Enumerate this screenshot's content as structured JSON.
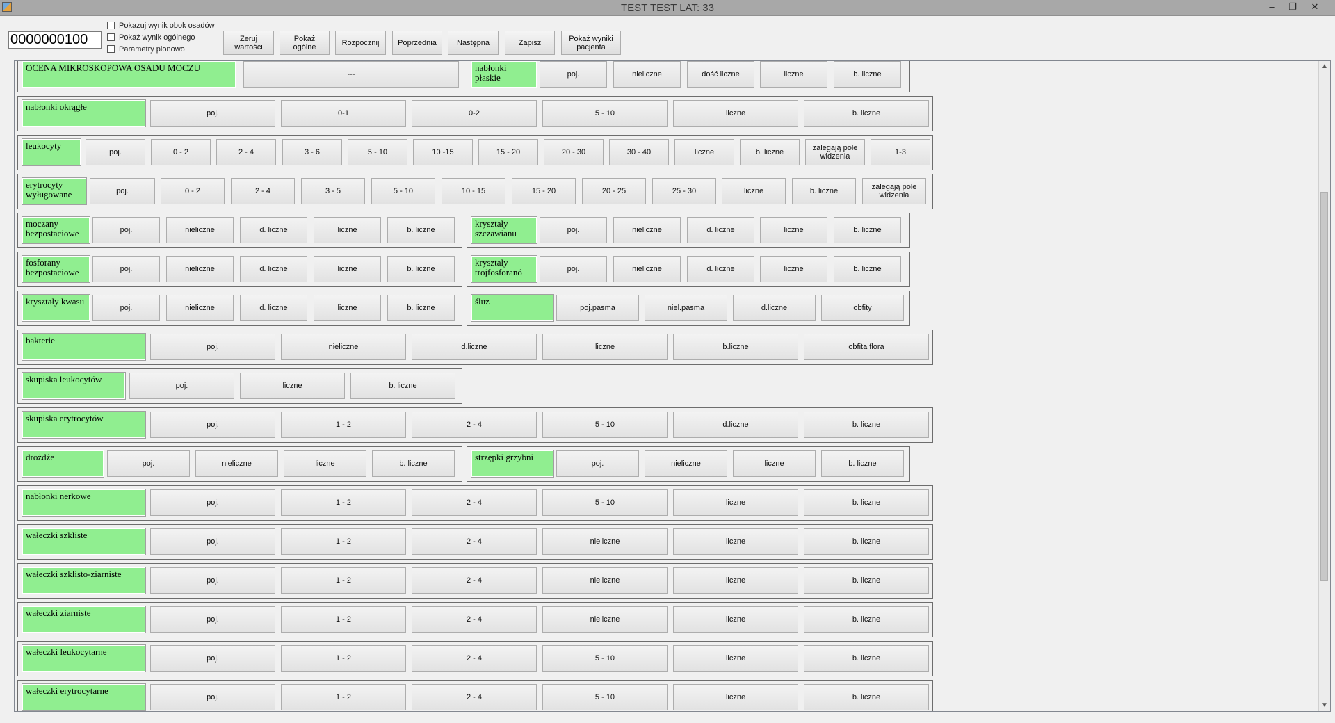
{
  "window": {
    "title": "TEST TEST  LAT: 33",
    "minimize": "–",
    "restore": "❐",
    "close": "✕"
  },
  "toolbar": {
    "id_value": "0000000100",
    "checkboxes": [
      {
        "label": "Pokazuj wynik obok osadów",
        "checked": false
      },
      {
        "label": "Pokaż wynik ogólnego",
        "checked": false
      },
      {
        "label": "Parametry pionowo",
        "checked": false
      }
    ],
    "buttons": [
      "Zeruj\nwartości",
      "Pokaż\nogólne",
      "Rozpocznij",
      "Poprzednia",
      "Następna",
      "Zapisz",
      "Pokaż wyniki\npacjenta"
    ]
  },
  "rows": [
    {
      "groups": [
        {
          "label": "OCENA MIKROSKOPOWA OSADU MOCZU",
          "options": [
            "---"
          ]
        },
        {
          "label": "nabłonki płaskie",
          "options": [
            "poj.",
            "nieliczne",
            "dość liczne",
            "liczne",
            "b. liczne"
          ]
        }
      ]
    },
    {
      "groups": [
        {
          "label": "nabłonki okrągłe",
          "options": [
            "poj.",
            "0-1",
            "0-2",
            "5 - 10",
            "liczne",
            "b. liczne"
          ]
        }
      ]
    },
    {
      "groups": [
        {
          "label": "leukocyty",
          "options": [
            "poj.",
            "0 - 2",
            "2 - 4",
            "3 - 6",
            "5 - 10",
            "10 -15",
            "15 - 20",
            "20 - 30",
            "30 - 40",
            "liczne",
            "b. liczne",
            "zalegają pole widzenia",
            "1-3"
          ]
        }
      ]
    },
    {
      "groups": [
        {
          "label": "erytrocyty wyługowane",
          "options": [
            "poj.",
            "0 - 2",
            "2 - 4",
            "3 - 5",
            "5 - 10",
            "10 - 15",
            "15 - 20",
            "20 - 25",
            "25 - 30",
            "liczne",
            "b. liczne",
            "zalegają pole widzenia"
          ]
        }
      ]
    },
    {
      "groups": [
        {
          "label": "moczany bezpostaciowe",
          "options": [
            "poj.",
            "nieliczne",
            "d. liczne",
            "liczne",
            "b. liczne"
          ]
        },
        {
          "label": "kryształy szczawianu",
          "options": [
            "poj.",
            "nieliczne",
            "d. liczne",
            "liczne",
            "b. liczne"
          ]
        }
      ]
    },
    {
      "groups": [
        {
          "label": "fosforany bezpostaciowe",
          "options": [
            "poj.",
            "nieliczne",
            "d. liczne",
            "liczne",
            "b. liczne"
          ]
        },
        {
          "label": "kryształy trojfosforanó",
          "options": [
            "poj.",
            "nieliczne",
            "d. liczne",
            "liczne",
            "b. liczne"
          ]
        }
      ]
    },
    {
      "groups": [
        {
          "label": "kryształy kwasu",
          "options": [
            "poj.",
            "nieliczne",
            "d. liczne",
            "liczne",
            "b. liczne"
          ]
        },
        {
          "label": "śluz",
          "options": [
            "poj.pasma",
            "niel.pasma",
            "d.liczne",
            "obfity"
          ]
        }
      ]
    },
    {
      "groups": [
        {
          "label": "bakterie",
          "options": [
            "poj.",
            "nieliczne",
            "d.liczne",
            "liczne",
            "b.liczne",
            "obfita flora"
          ]
        }
      ]
    },
    {
      "groups": [
        {
          "label": "skupiska leukocytów",
          "options": [
            "poj.",
            "liczne",
            "b. liczne"
          ]
        }
      ]
    },
    {
      "groups": [
        {
          "label": "skupiska erytrocytów",
          "options": [
            "poj.",
            "1 - 2",
            "2 - 4",
            "5 - 10",
            "d.liczne",
            "b. liczne"
          ]
        }
      ]
    },
    {
      "groups": [
        {
          "label": "drożdże",
          "options": [
            "poj.",
            "nieliczne",
            "liczne",
            "b. liczne"
          ]
        },
        {
          "label": "strzępki grzybni",
          "options": [
            "poj.",
            "nieliczne",
            "liczne",
            "b. liczne"
          ]
        }
      ]
    },
    {
      "groups": [
        {
          "label": "nabłonki nerkowe",
          "options": [
            "poj.",
            "1 - 2",
            "2 - 4",
            "5 - 10",
            "liczne",
            "b. liczne"
          ]
        }
      ]
    },
    {
      "groups": [
        {
          "label": "wałeczki szkliste",
          "options": [
            "poj.",
            "1 - 2",
            "2 - 4",
            "nieliczne",
            "liczne",
            "b. liczne"
          ]
        }
      ]
    },
    {
      "groups": [
        {
          "label": "wałeczki szklisto-ziarniste",
          "options": [
            "poj.",
            "1 - 2",
            "2 - 4",
            "nieliczne",
            "liczne",
            "b. liczne"
          ]
        }
      ]
    },
    {
      "groups": [
        {
          "label": "wałeczki ziarniste",
          "options": [
            "poj.",
            "1 - 2",
            "2 - 4",
            "nieliczne",
            "liczne",
            "b. liczne"
          ]
        }
      ]
    },
    {
      "groups": [
        {
          "label": "wałeczki leukocytarne",
          "options": [
            "poj.",
            "1 - 2",
            "2 - 4",
            "5 - 10",
            "liczne",
            "b. liczne"
          ]
        }
      ]
    },
    {
      "groups": [
        {
          "label": "wałeczki erytrocytarne",
          "options": [
            "poj.",
            "1 - 2",
            "2 - 4",
            "5 - 10",
            "liczne",
            "b. liczne"
          ]
        }
      ]
    }
  ],
  "colors": {
    "label_bg": "#90ee90",
    "titlebar": "#a8a8a8"
  }
}
